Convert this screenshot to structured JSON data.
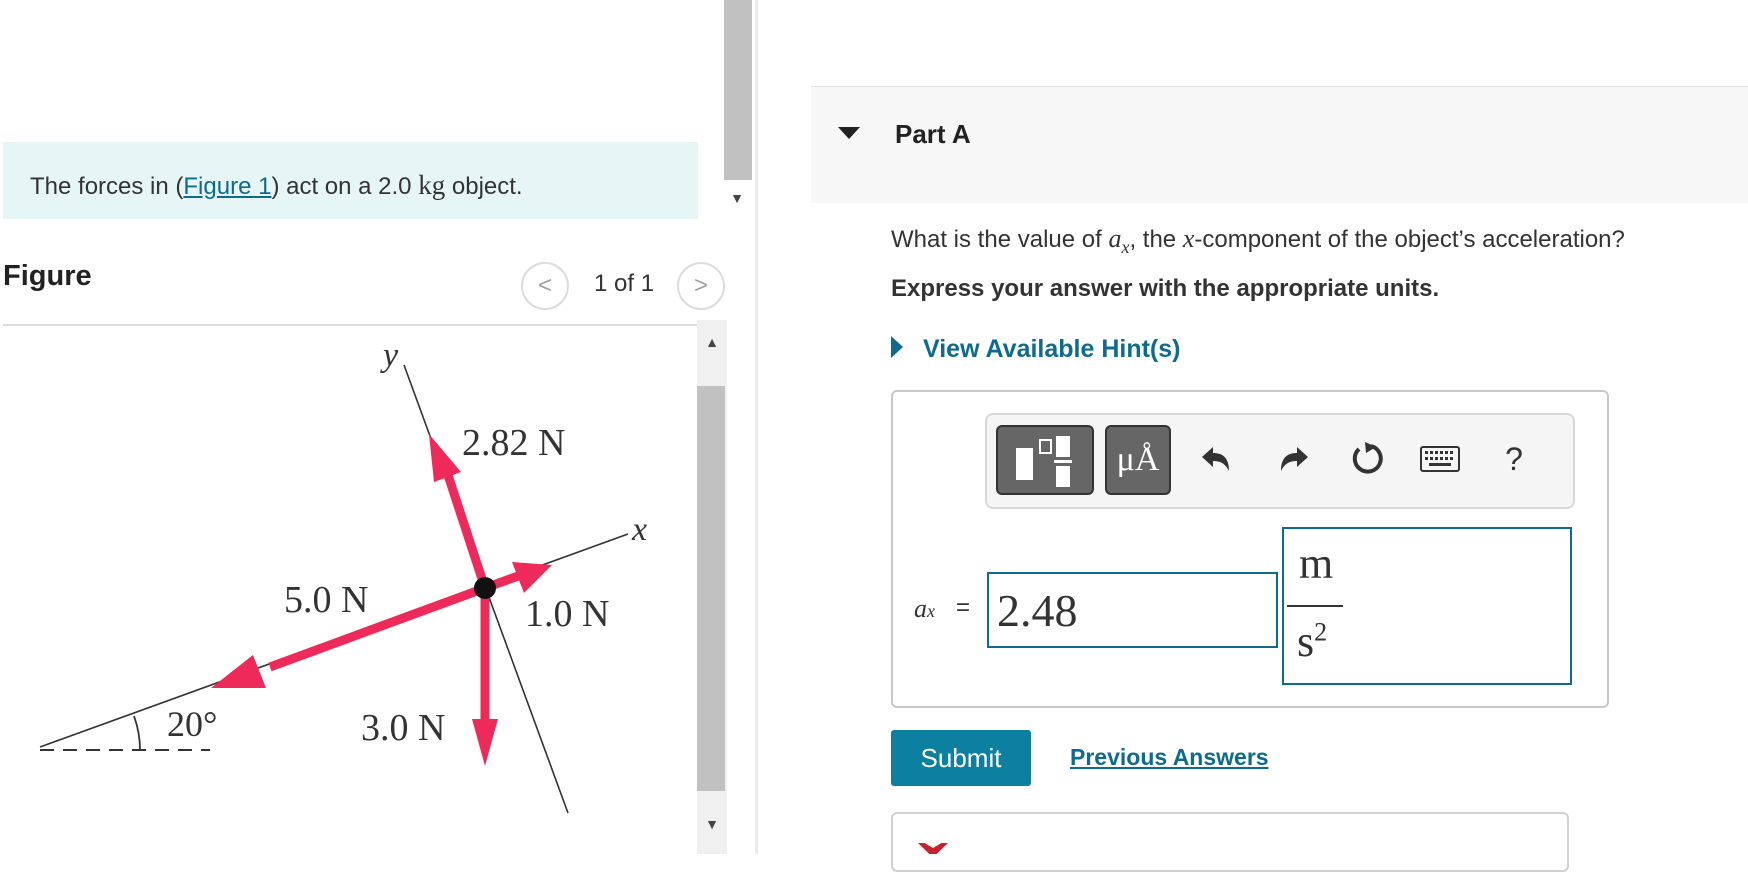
{
  "problem": {
    "intro_prefix": "The forces in (",
    "figure_link": "Figure 1",
    "intro_middle": ") act on a 2.0 ",
    "intro_unit": "kg",
    "intro_suffix": " object."
  },
  "figure_panel": {
    "title": "Figure",
    "pager": "1 of 1",
    "prev_icon": "chevron-left-icon",
    "next_icon": "chevron-right-icon"
  },
  "diagram": {
    "axis_y": "y",
    "axis_x": "x",
    "labels": {
      "f1": "2.82 N",
      "f2": "5.0 N",
      "f3": "1.0 N",
      "f4": "3.0 N",
      "angle": "20°"
    },
    "colors": {
      "force": "#ee2a5a",
      "axis": "#333333"
    }
  },
  "part_a": {
    "title": "Part A",
    "question_prefix": "What is the value of ",
    "question_var": "a",
    "question_var_sub": "x",
    "question_middle": ", the ",
    "question_x": "x",
    "question_suffix": "-component of the object’s acceleration?",
    "instruction": "Express your answer with the appropriate units.",
    "hint_label": "View Available Hint(s)"
  },
  "answer": {
    "toolbar": {
      "template_icon": "fraction-template-icon",
      "units_label": "μÅ",
      "undo_icon": "undo-icon",
      "redo_icon": "redo-icon",
      "reset_icon": "reset-icon",
      "keyboard_icon": "keyboard-icon",
      "help_label": "?"
    },
    "var_label": "a",
    "var_sub": "x",
    "equals": "=",
    "value": "2.48",
    "unit_numerator": "m",
    "unit_denominator": "s",
    "unit_exponent": "2",
    "submit_label": "Submit",
    "previous_answers_label": "Previous Answers"
  },
  "theme": {
    "accent": "#0d7fa0",
    "link": "#0d6c8e",
    "intro_bg": "#e6f5f6",
    "error": "#c9202c"
  }
}
